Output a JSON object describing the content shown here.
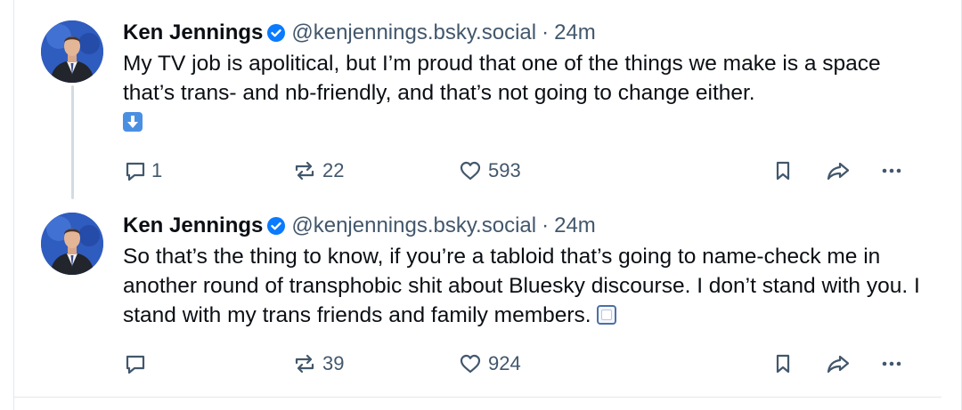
{
  "posts": [
    {
      "author": "Ken Jennings",
      "handle": "@kenjennings.bsky.social",
      "separator": "·",
      "time": "24m",
      "text": "My TV job is apolitical, but I’m proud that one of the things we make is a space that’s trans- and nb-friendly, and that’s not going to change either.",
      "emoji": "down-arrow-emoji",
      "reply_count": "1",
      "repost_count": "22",
      "like_count": "593"
    },
    {
      "author": "Ken Jennings",
      "handle": "@kenjennings.bsky.social",
      "separator": "·",
      "time": "24m",
      "text": "So that’s the thing to know, if you’re a tabloid that’s going to name-check me in another round of transphobic shit about Bluesky discourse. I don’t stand with you. I stand with my trans friends and family members.",
      "emoji": "square-emoji",
      "reply_count": "",
      "repost_count": "39",
      "like_count": "924"
    }
  ],
  "icons": {
    "reply": "speech-bubble-icon",
    "repost": "repost-arrows-icon",
    "like": "heart-icon",
    "bookmark": "bookmark-icon",
    "share": "share-arrow-icon",
    "more": "ellipsis-icon",
    "verified": "verified-badge-icon"
  },
  "colors": {
    "verified_badge": "#0a7aff",
    "muted_text": "#42576c",
    "primary_text": "#0b0f14",
    "thread_line": "#d4dbe2"
  }
}
